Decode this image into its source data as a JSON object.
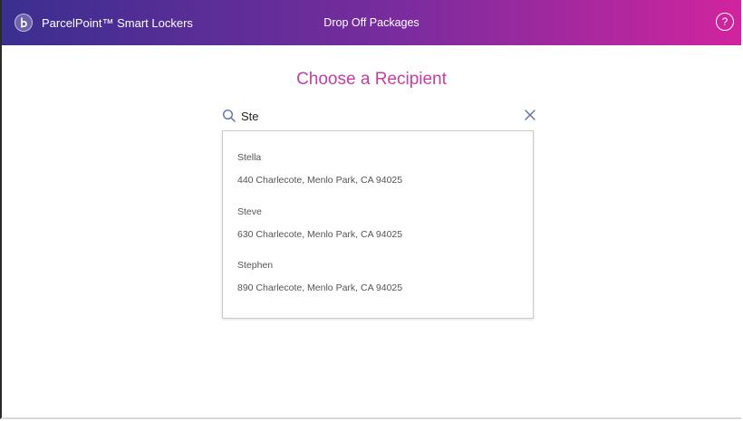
{
  "header": {
    "brand_name": "ParcelPoint™ Smart Lockers",
    "title": "Drop Off Packages",
    "help_label": "?",
    "gradient_start": "#3a2f8f",
    "gradient_end": "#d1249e"
  },
  "main": {
    "title": "Choose a Recipient",
    "title_color": "#c63ea3"
  },
  "search": {
    "value": "Ste",
    "placeholder": ""
  },
  "results": [
    {
      "name": "Stella",
      "address": "440 Charlecote, Menlo Park, CA 94025"
    },
    {
      "name": "Steve",
      "address": "630 Charlecote, Menlo Park, CA 94025"
    },
    {
      "name": "Stephen",
      "address": "890 Charlecote, Menlo Park, CA 94025"
    }
  ]
}
